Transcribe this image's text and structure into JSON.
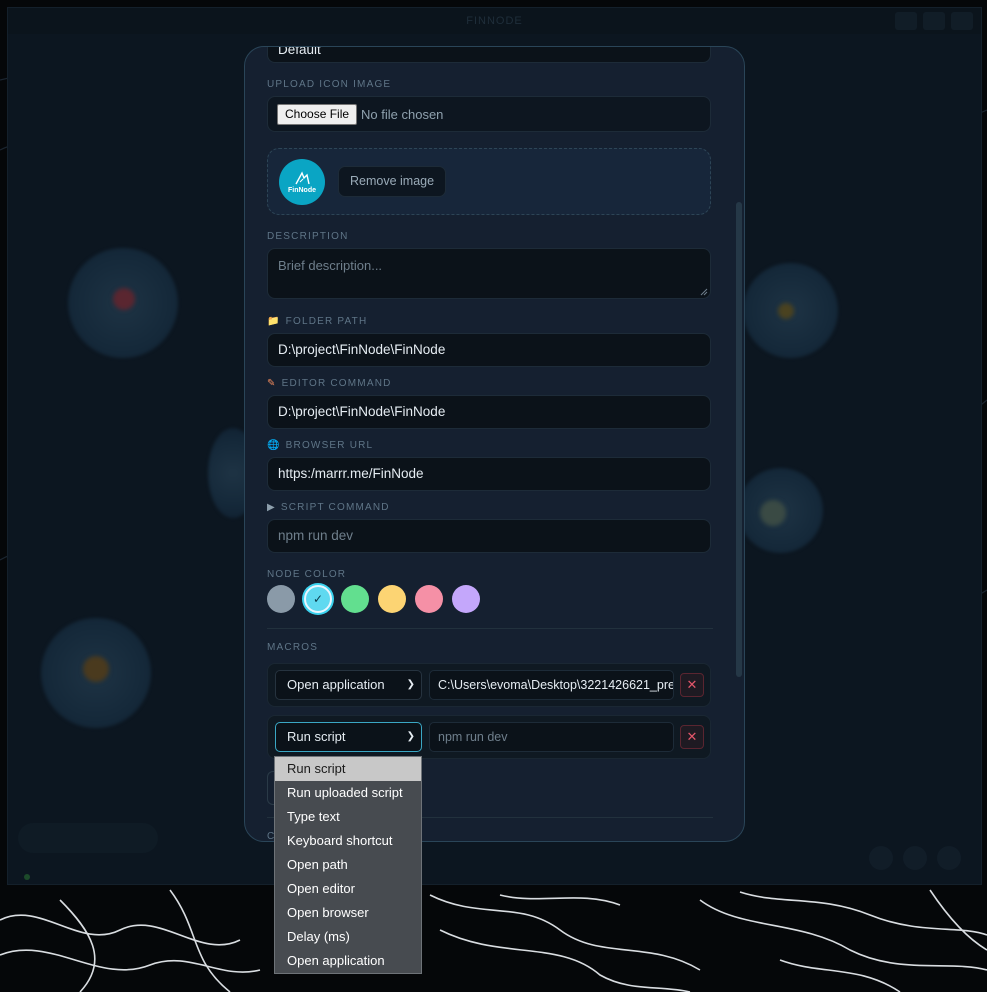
{
  "app": {
    "title": "FINNODE"
  },
  "form": {
    "top_field_value": "Default",
    "upload_icon": {
      "label": "UPLOAD ICON IMAGE",
      "choose_button": "Choose File",
      "no_file_text": "No file chosen"
    },
    "image_preview": {
      "avatar_text": "FinNode",
      "remove_button": "Remove image"
    },
    "description": {
      "label": "DESCRIPTION",
      "placeholder": "Brief description..."
    },
    "folder_path": {
      "label": "FOLDER PATH",
      "icon": "folder-icon",
      "value": "D:\\project\\FinNode\\FinNode"
    },
    "editor_command": {
      "label": "EDITOR COMMAND",
      "icon": "pencil-icon",
      "value": "D:\\project\\FinNode\\FinNode"
    },
    "browser_url": {
      "label": "BROWSER URL",
      "icon": "globe-icon",
      "value": "https:/marrr.me/FinNode"
    },
    "script_command": {
      "label": "SCRIPT COMMAND",
      "icon": "play-icon",
      "placeholder": "npm run dev"
    },
    "node_color": {
      "label": "NODE COLOR",
      "selected_index": 1,
      "swatches": [
        "#8a9aa8",
        "#5fd9f0",
        "#62df8f",
        "#fcd473",
        "#f590a6",
        "#c4a7fb"
      ]
    },
    "macros": {
      "label": "MACROS",
      "rows": [
        {
          "type": "Open application",
          "value": "C:\\Users\\evoma\\Desktop\\3221426621_pre",
          "delete": "✕"
        },
        {
          "type": "Run script",
          "value_placeholder": "npm run dev",
          "delete": "✕"
        }
      ]
    },
    "cut_off_label": "C"
  },
  "dropdown": {
    "selected": "Run script",
    "options": [
      "Run script",
      "Run uploaded script",
      "Type text",
      "Keyboard shortcut",
      "Open path",
      "Open editor",
      "Open browser",
      "Delay (ms)",
      "Open application"
    ]
  },
  "colors": {
    "accent": "#3bd2ee",
    "modal_bg": "#152030",
    "danger": "#e2566a"
  }
}
